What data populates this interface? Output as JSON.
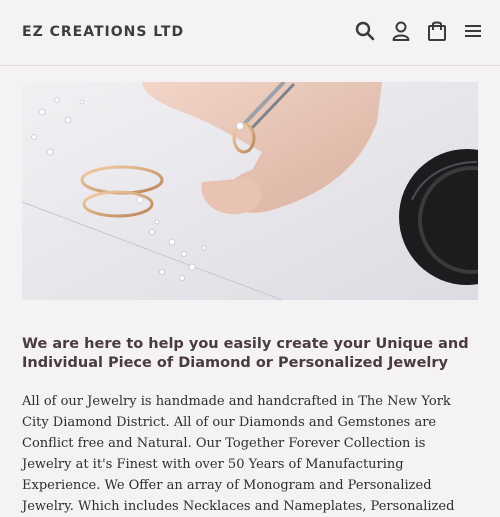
{
  "header": {
    "brand": "EZ CREATIONS LTD",
    "icons": [
      "search-icon",
      "account-icon",
      "cart-icon",
      "menu-icon"
    ]
  },
  "hero": {
    "alt_subject": "hand placing diamond ring with tweezers"
  },
  "content": {
    "headline": "We are here to help you easily create your Unique and Individual Piece of Diamond or Personalized Jewelry",
    "body": "All of our Jewelry is handmade and handcrafted in The New York City Diamond District. All of our Diamonds and Gemstones are Conflict free and Natural. Our Together Forever Collection is Jewelry at it's Finest with over 50 Years of Manufacturing Experience. We Offer an array of Monogram and Personalized Jewelry. Which includes Necklaces and Nameplates, Personalized"
  },
  "colors": {
    "background": "#f5f2f3",
    "brand_text": "#3d3d3d",
    "headline": "#4a3b40"
  }
}
